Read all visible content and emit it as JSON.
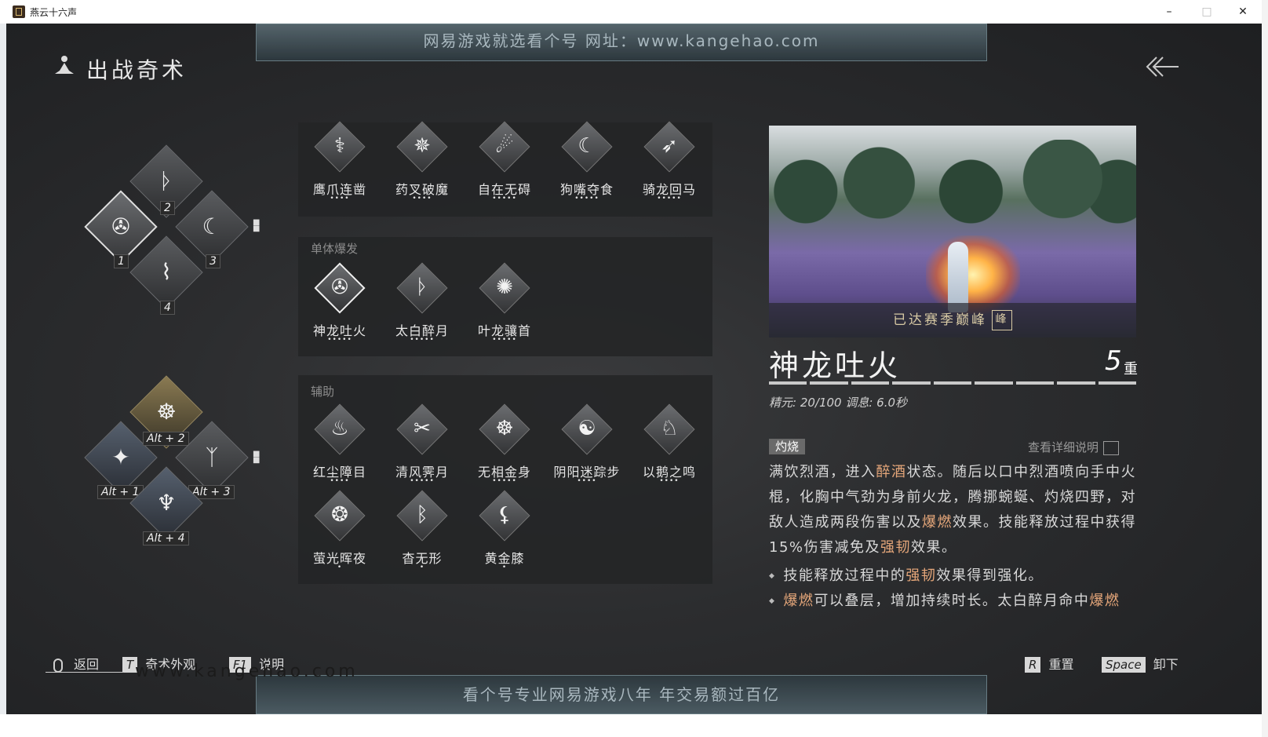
{
  "window": {
    "title": "燕云十六声",
    "min": "–",
    "max": "□",
    "close": "✕"
  },
  "watermark": {
    "top": "网易游戏就选看个号   网址：www.kangehao.com",
    "bottom": "看个号专业网易游戏八年   年交易额过百亿",
    "site": "www.kangehao.com"
  },
  "header": {
    "title": "出战奇术",
    "icon": "meditation-icon",
    "back_icon": "double-chevron-left-icon"
  },
  "slots_main": [
    {
      "num": "1",
      "glyph": "✇",
      "selected": true
    },
    {
      "num": "2",
      "glyph": "ᚦ"
    },
    {
      "num": "3",
      "glyph": "☾"
    },
    {
      "num": "4",
      "glyph": "⌇"
    }
  ],
  "slots_alt": [
    {
      "num": "Alt + 1",
      "glyph": "✦"
    },
    {
      "num": "Alt + 2",
      "glyph": "☸"
    },
    {
      "num": "Alt + 3",
      "glyph": "ᛉ"
    },
    {
      "num": "Alt + 4",
      "glyph": "♆"
    }
  ],
  "groups": {
    "top": {
      "label": "",
      "skills": [
        {
          "name": "鹰爪连凿",
          "pips": "••••",
          "glyph": "⚕"
        },
        {
          "name": "药叉破魔",
          "pips": "••••",
          "glyph": "✵"
        },
        {
          "name": "自在无碍",
          "pips": "•••••",
          "glyph": "☄"
        },
        {
          "name": "狗嘴夺食",
          "pips": "•••••",
          "glyph": "☾"
        },
        {
          "name": "骑龙回马",
          "pips": "•••••",
          "glyph": "➶"
        }
      ]
    },
    "burst": {
      "label": "单体爆发",
      "skills": [
        {
          "name": "神龙吐火",
          "pips": "•••••",
          "glyph": "✇",
          "active": true
        },
        {
          "name": "太白醉月",
          "pips": "•••••",
          "glyph": "ᚦ"
        },
        {
          "name": "叶龙骧首",
          "pips": "•••••",
          "glyph": "✺"
        }
      ]
    },
    "support": {
      "label": "辅助",
      "skills": [
        {
          "name": "红尘障目",
          "pips": "••••",
          "glyph": "♨"
        },
        {
          "name": "清风霁月",
          "pips": "•••••",
          "glyph": "✂"
        },
        {
          "name": "无相金身",
          "pips": "•••••",
          "glyph": "☸"
        },
        {
          "name": "阴阳迷踪步",
          "pips": "••••",
          "glyph": "☯"
        },
        {
          "name": "以鹅之鸣",
          "pips": "••••",
          "glyph": "♘"
        },
        {
          "name": "萤光晖夜",
          "pips": "•",
          "glyph": "❂"
        },
        {
          "name": "杳无形",
          "pips": "•",
          "glyph": "ᛒ"
        },
        {
          "name": "黄金膝",
          "pips": "•",
          "glyph": "⚸"
        }
      ]
    }
  },
  "detail": {
    "banner": "已达赛季巅峰",
    "banner_icon": "峰",
    "name": "神龙吐火",
    "level": "5",
    "level_unit": "重",
    "stats": "精元: 20/100   调息: 6.0秒",
    "tag": "灼烧",
    "details_link": "查看详细说明",
    "desc": {
      "p1": "满饮烈酒，进入",
      "h1": "醉酒",
      "p2": "状态。随后以口中烈酒喷向手中火棍，化胸中气劲为身前火龙，腾挪蜿蜒、灼烧四野，对敌人造成两段伤害以及",
      "h2": "爆燃",
      "p3": "效果。技能释放过程中获得15%伤害减免及",
      "h3": "强韧",
      "p4": "效果。"
    },
    "bullet1": {
      "p1": "技能释放过程中的",
      "h1": "强韧",
      "p2": "效果得到强化。"
    },
    "bullet2": {
      "h1": "爆燃",
      "p1": "可以叠层，增加持续时长。太白醉月命中",
      "h2": "爆燃"
    }
  },
  "footer": {
    "back_label": "返回",
    "t_key": "T",
    "t_label": "奇术外观",
    "f1_key": "F1",
    "f1_label": "说明",
    "r_key": "R",
    "r_label": "重置",
    "space_key": "Space",
    "space_label": "卸下"
  },
  "colors": {
    "highlight": "#e6a77a",
    "background": "#2c2d2f"
  }
}
